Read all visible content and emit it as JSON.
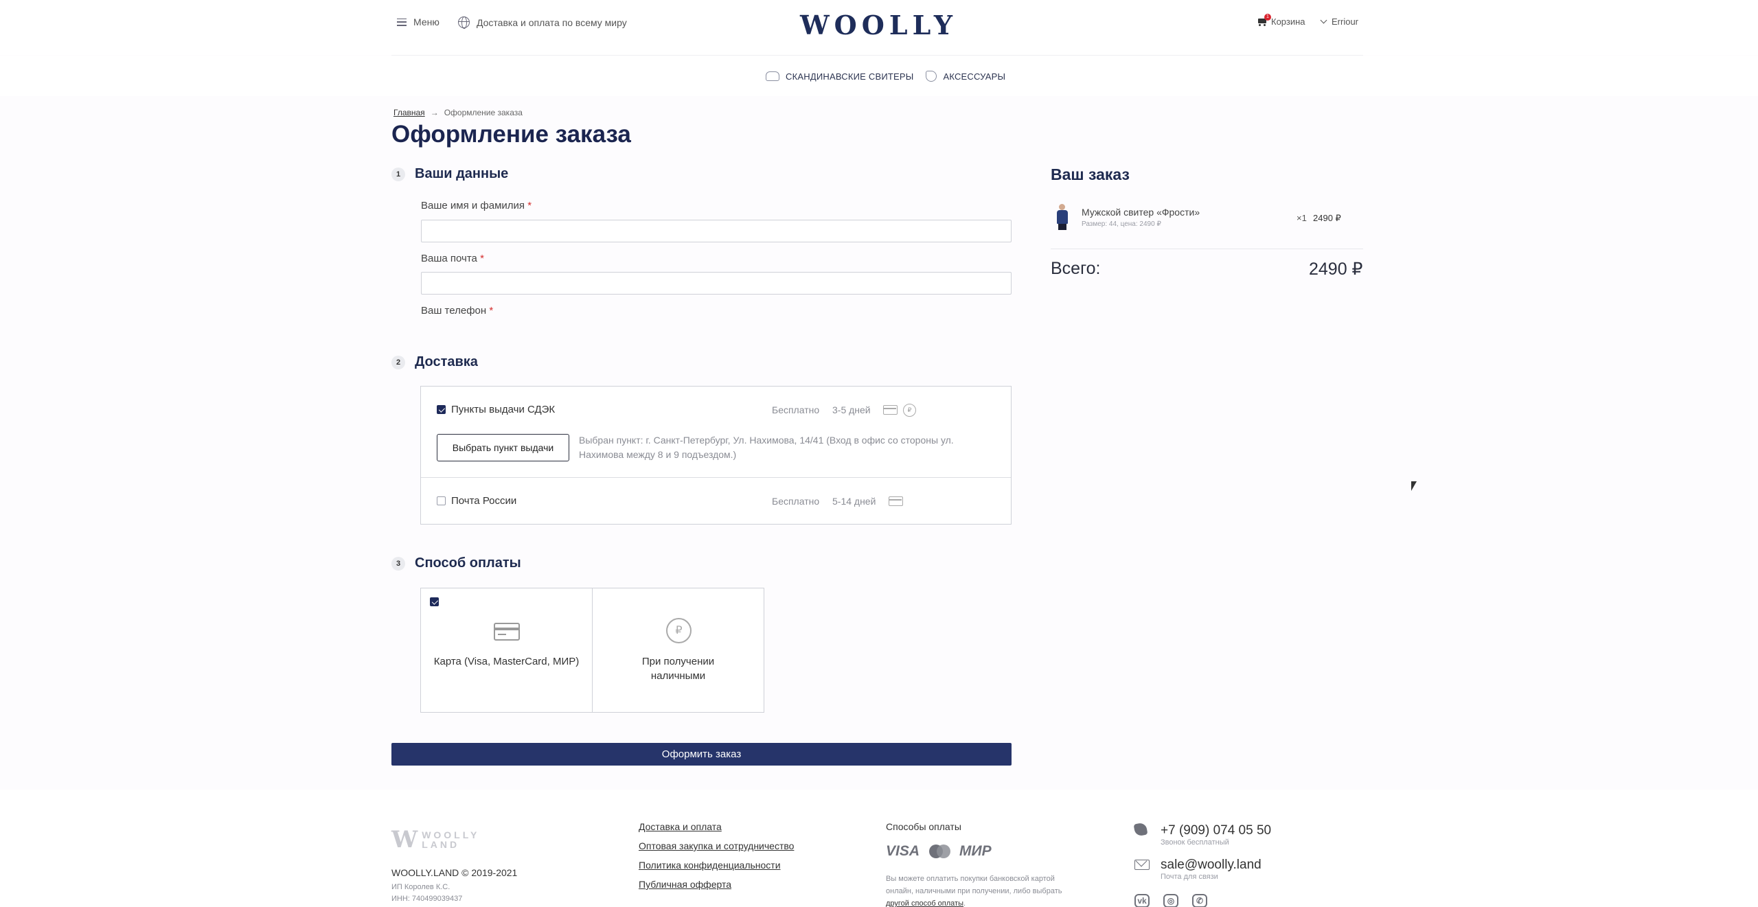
{
  "header": {
    "menu_label": "Меню",
    "shipping_label": "Доставка и оплата по всему миру",
    "logo": "WOOLLY",
    "cart_label": "Корзина",
    "cart_count": "1",
    "user_label": "Erriour"
  },
  "categories": [
    {
      "label": "СКАНДИНАВСКИЕ СВИТЕРЫ",
      "icon": "sweater-icon"
    },
    {
      "label": "АКСЕССУАРЫ",
      "icon": "mitten-icon"
    }
  ],
  "breadcrumb": {
    "home": "Главная",
    "sep": "→",
    "current": "Оформление заказа"
  },
  "page_title": "Оформление заказа",
  "form": {
    "step1": {
      "num": "1",
      "title": "Ваши данные"
    },
    "name_label": "Ваше имя и фамилия",
    "email_label": "Ваша почта",
    "phone_label": "Ваш телефон",
    "required_mark": "*",
    "name_value": "",
    "email_value": ""
  },
  "delivery": {
    "step": {
      "num": "2",
      "title": "Доставка"
    },
    "options": [
      {
        "name": "Пункты выдачи СДЭК",
        "price": "Бесплатно",
        "days": "3-5 дней",
        "checked": true
      },
      {
        "name": "Почта России",
        "price": "Бесплатно",
        "days": "5-14 дней",
        "checked": false
      }
    ],
    "pick_button": "Выбрать пункт выдачи",
    "picked_address": "Выбран пункт: г. Санкт-Петербург, Ул. Нахимова, 14/41 (Вход в офис со стороны ул. Нахимова между 8 и 9 подъездом.)",
    "coin_glyph": "₽"
  },
  "payment": {
    "step": {
      "num": "3",
      "title": "Способ оплаты"
    },
    "options": [
      {
        "label": "Карта (Visa, MasterCard, МИР)",
        "checked": true
      },
      {
        "label": "При получении наличными",
        "checked": false
      }
    ]
  },
  "submit_label": "Оформить заказ",
  "order": {
    "title": "Ваш заказ",
    "item": {
      "name": "Мужской свитер «Фрости»",
      "details": "Размер: 44, цена: 2490 ₽",
      "qty": "×1",
      "price": "2490 ₽"
    },
    "total_label": "Всего:",
    "total_value": "2490 ₽"
  },
  "footer": {
    "logo_top": "WOOLLY",
    "logo_bottom": "LAND",
    "copyright": "WOOLLY.LAND © 2019-2021",
    "ip": "ИП Королев К.С.",
    "inn": "ИНН: 740499039437",
    "links": [
      "Доставка и оплата",
      "Оптовая закупка и сотрудничество",
      "Политика конфиденциальности",
      "Публичная офферта"
    ],
    "payments_title": "Способы оплаты",
    "payment_logos": [
      "VISA",
      "MasterCard",
      "МИР"
    ],
    "payments_text": "Вы можете оплатить покупки банковской картой онлайн, наличными при получении, либо выбрать",
    "payments_link": "другой способ оплаты",
    "phone": "+7 (909) 074 05 50",
    "phone_note": "Звонок бесплатный",
    "email": "sale@woolly.land",
    "email_note": "Почта для связи",
    "socials": [
      "vk-icon",
      "instagram-icon",
      "whatsapp-icon"
    ]
  },
  "colors": {
    "brand": "#1e2d5a",
    "button": "#26346a",
    "required": "#d42e2e",
    "badge": "#d9232e"
  }
}
